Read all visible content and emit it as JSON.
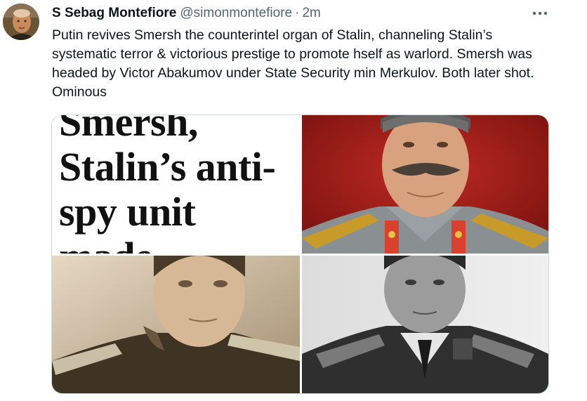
{
  "author": {
    "name": "S Sebag Montefiore",
    "handle": "@simonmontefiore",
    "separator": "·",
    "time": "2m",
    "avatar_icon": "avatar-photo"
  },
  "more_icon": "more-horizontal-icon",
  "tweet_text": "Putin revives Smersh the counterintel organ of Stalin, channeling Stalin’s systematic terror & victorious prestige to promote hself as warlord. Smersh was headed by Victor Abakumov under State Security min Merkulov. Both later shot. Ominous",
  "media": {
    "article_headline_lines": [
      "Smersh,",
      "Stalin’s anti-",
      "spy unit",
      "made"
    ]
  },
  "colors": {
    "text": "#0f1419",
    "secondary": "#536471",
    "border": "#cfd9de"
  }
}
